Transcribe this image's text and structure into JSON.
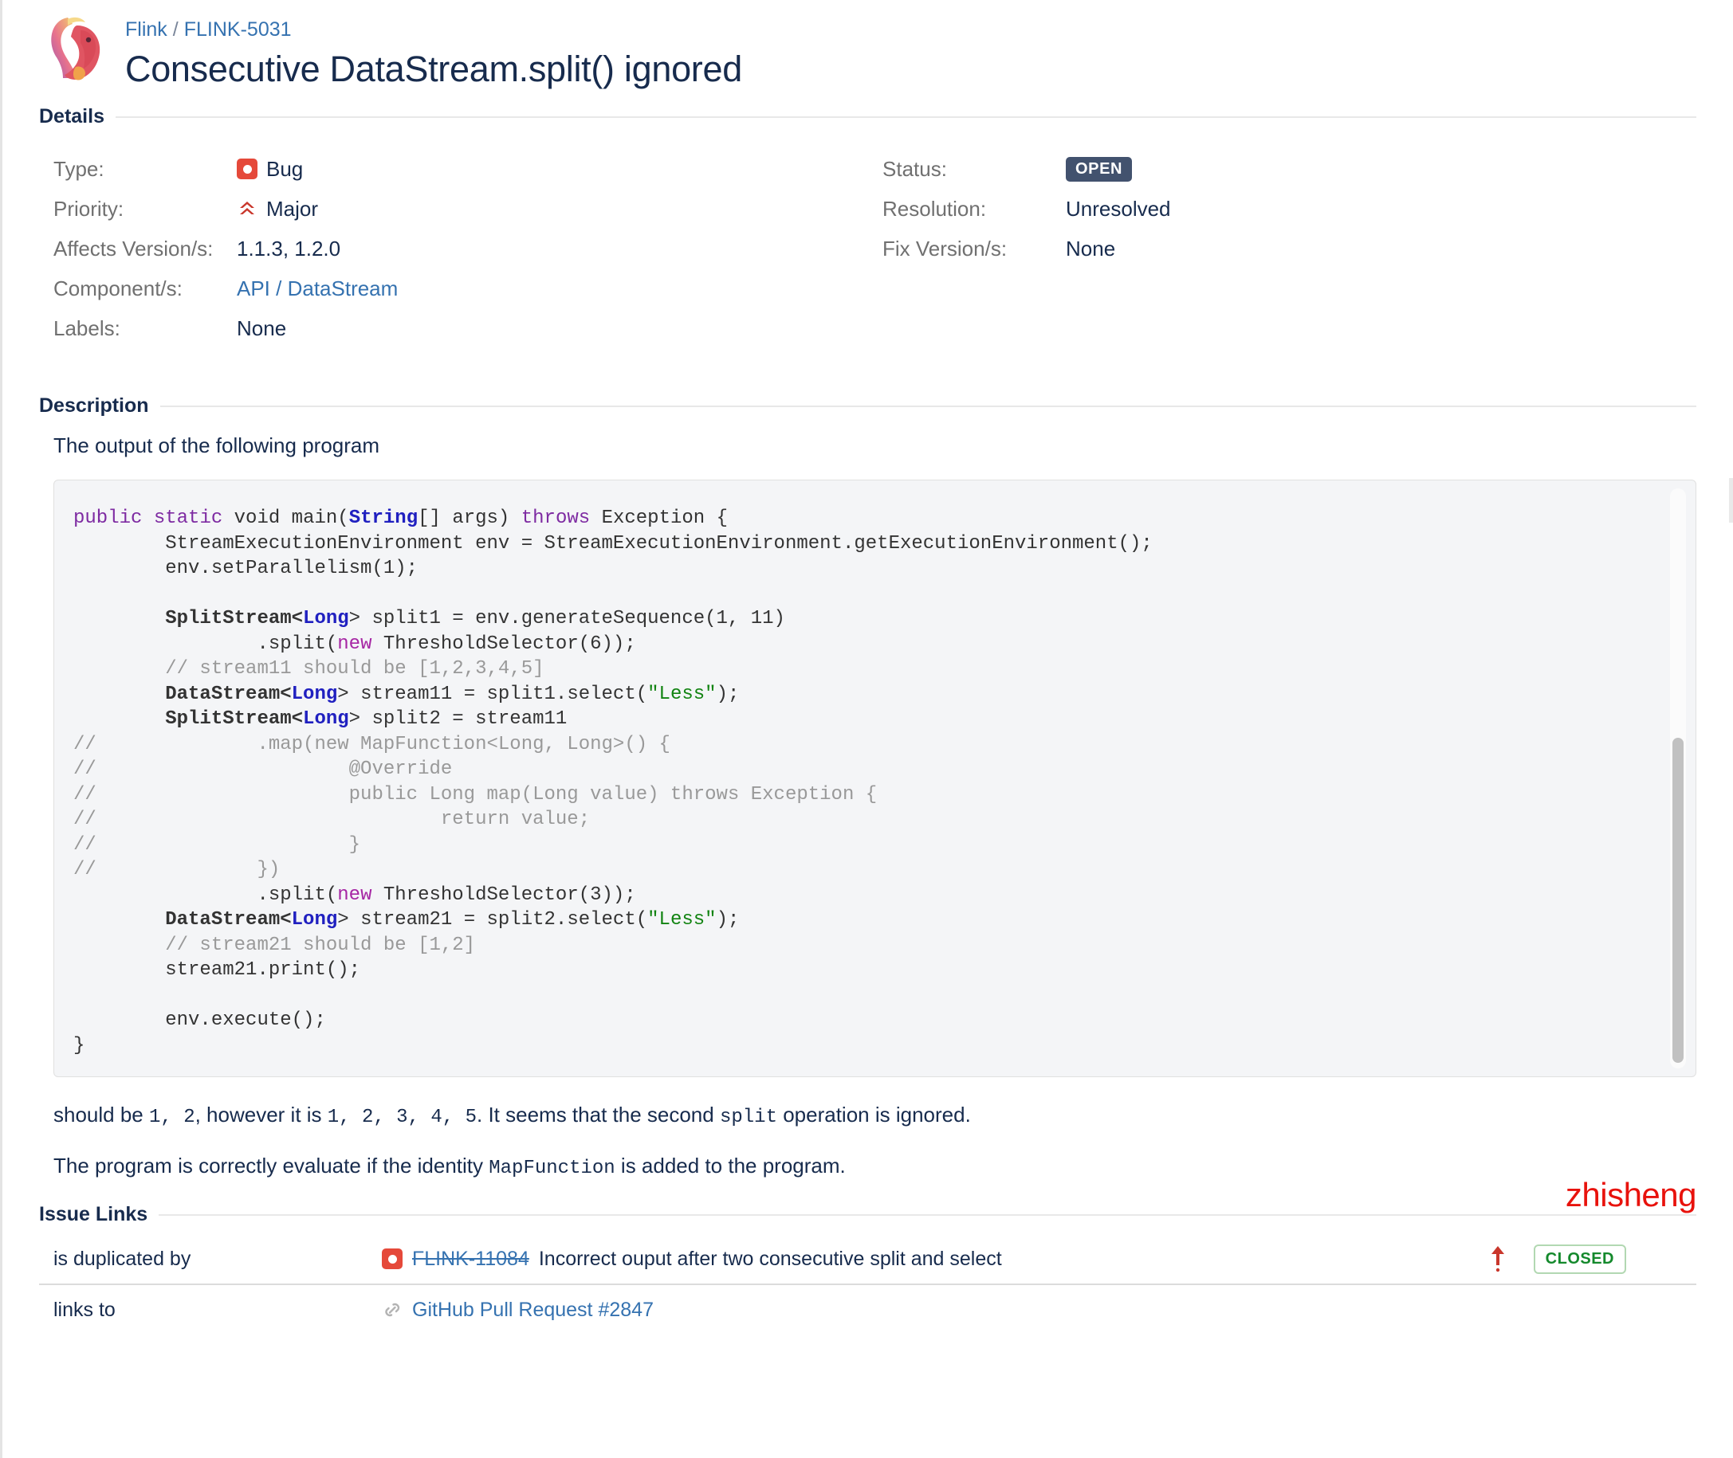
{
  "header": {
    "breadcrumb": {
      "project": "Flink",
      "separator": "/",
      "issue_key": "FLINK-5031"
    },
    "title": "Consecutive DataStream.split() ignored",
    "avatar_name": "flink-squirrel-logo"
  },
  "details": {
    "heading": "Details",
    "left_fields": [
      {
        "label": "Type:",
        "value": "Bug",
        "icon": "bug-icon"
      },
      {
        "label": "Priority:",
        "value": "Major",
        "icon": "priority-major-icon"
      },
      {
        "label": "Affects Version/s:",
        "value": "1.1.3, 1.2.0"
      },
      {
        "label": "Component/s:",
        "value": "API / DataStream",
        "link": true
      },
      {
        "label": "Labels:",
        "value": "None"
      }
    ],
    "right_fields": [
      {
        "label": "Status:",
        "value": "OPEN",
        "lozenge": true
      },
      {
        "label": "Resolution:",
        "value": "Unresolved"
      },
      {
        "label": "Fix Version/s:",
        "value": "None"
      }
    ]
  },
  "description": {
    "heading": "Description",
    "intro": "The output of the following program",
    "code_lines": [
      [
        {
          "t": "public ",
          "c": "kw"
        },
        {
          "t": "static ",
          "c": "kw"
        },
        {
          "t": "void main(",
          "c": ""
        },
        {
          "t": "String",
          "c": "type"
        },
        {
          "t": "[] args) ",
          "c": ""
        },
        {
          "t": "throws ",
          "c": "kw"
        },
        {
          "t": "Exception {",
          "c": ""
        }
      ],
      [
        {
          "t": "        StreamExecutionEnvironment env = StreamExecutionEnvironment.getExecutionEnvironment();",
          "c": ""
        }
      ],
      [
        {
          "t": "        env.setParallelism(1);",
          "c": ""
        }
      ],
      [
        {
          "t": "",
          "c": ""
        }
      ],
      [
        {
          "t": "        SplitStream<",
          "c": "bold"
        },
        {
          "t": "Long",
          "c": "type"
        },
        {
          "t": "> split1 = env.generateSequence(1, 11)",
          "c": ""
        }
      ],
      [
        {
          "t": "                .split(",
          "c": ""
        },
        {
          "t": "new ",
          "c": "kw2"
        },
        {
          "t": "ThresholdSelector(6));",
          "c": ""
        }
      ],
      [
        {
          "t": "        // stream11 should be [1,2,3,4,5]",
          "c": "cmt"
        }
      ],
      [
        {
          "t": "        DataStream<",
          "c": "bold"
        },
        {
          "t": "Long",
          "c": "type"
        },
        {
          "t": "> stream11 = split1.select(",
          "c": ""
        },
        {
          "t": "\"Less\"",
          "c": "str"
        },
        {
          "t": ");",
          "c": ""
        }
      ],
      [
        {
          "t": "        SplitStream<",
          "c": "bold"
        },
        {
          "t": "Long",
          "c": "type"
        },
        {
          "t": "> split2 = stream11",
          "c": ""
        }
      ],
      [
        {
          "t": "//              .map(new MapFunction<Long, Long>() {",
          "c": "cmt"
        }
      ],
      [
        {
          "t": "//                      @Override",
          "c": "cmt"
        }
      ],
      [
        {
          "t": "//                      public Long map(Long value) throws Exception {",
          "c": "cmt"
        }
      ],
      [
        {
          "t": "//                              return value;",
          "c": "cmt"
        }
      ],
      [
        {
          "t": "//                      }",
          "c": "cmt"
        }
      ],
      [
        {
          "t": "//              })",
          "c": "cmt"
        }
      ],
      [
        {
          "t": "                .split(",
          "c": ""
        },
        {
          "t": "new ",
          "c": "kw2"
        },
        {
          "t": "ThresholdSelector(3));",
          "c": ""
        }
      ],
      [
        {
          "t": "        DataStream<",
          "c": "bold"
        },
        {
          "t": "Long",
          "c": "type"
        },
        {
          "t": "> stream21 = split2.select(",
          "c": ""
        },
        {
          "t": "\"Less\"",
          "c": "str"
        },
        {
          "t": ");",
          "c": ""
        }
      ],
      [
        {
          "t": "        // stream21 should be [1,2]",
          "c": "cmt"
        }
      ],
      [
        {
          "t": "        stream21.print();",
          "c": ""
        }
      ],
      [
        {
          "t": "",
          "c": ""
        }
      ],
      [
        {
          "t": "        env.execute();",
          "c": ""
        }
      ],
      [
        {
          "t": "}",
          "c": ""
        }
      ]
    ],
    "para1_parts": [
      {
        "t": "should be ",
        "mono": false
      },
      {
        "t": "1, 2",
        "mono": true
      },
      {
        "t": ", however it is ",
        "mono": false
      },
      {
        "t": "1, 2, 3, 4, 5",
        "mono": true
      },
      {
        "t": ". It seems that the second ",
        "mono": false
      },
      {
        "t": "split",
        "mono": true
      },
      {
        "t": " operation is ignored.",
        "mono": false
      }
    ],
    "para2_parts": [
      {
        "t": "The program is correctly evaluate if the identity ",
        "mono": false
      },
      {
        "t": "MapFunction",
        "mono": true
      },
      {
        "t": " is added to the program.",
        "mono": false
      }
    ]
  },
  "issue_links": {
    "heading": "Issue Links",
    "watermark": "zhisheng",
    "rows": [
      {
        "type": "is duplicated by",
        "icon": "bug-icon",
        "key": "FLINK-11084",
        "key_resolved": true,
        "summary": "Incorrect ouput after two consecutive split and select",
        "arrow": "priority-up-icon",
        "status": "CLOSED"
      },
      {
        "type": "links to",
        "icon": "link-chain-icon",
        "key": "GitHub Pull Request #2847",
        "key_resolved": false,
        "summary": "",
        "arrow": "",
        "status": ""
      }
    ]
  },
  "colors": {
    "link": "#3572b0",
    "bug_red": "#e5493a",
    "status_open": "#42526e",
    "status_closed": "#14892c",
    "watermark_red": "#e8120c"
  }
}
